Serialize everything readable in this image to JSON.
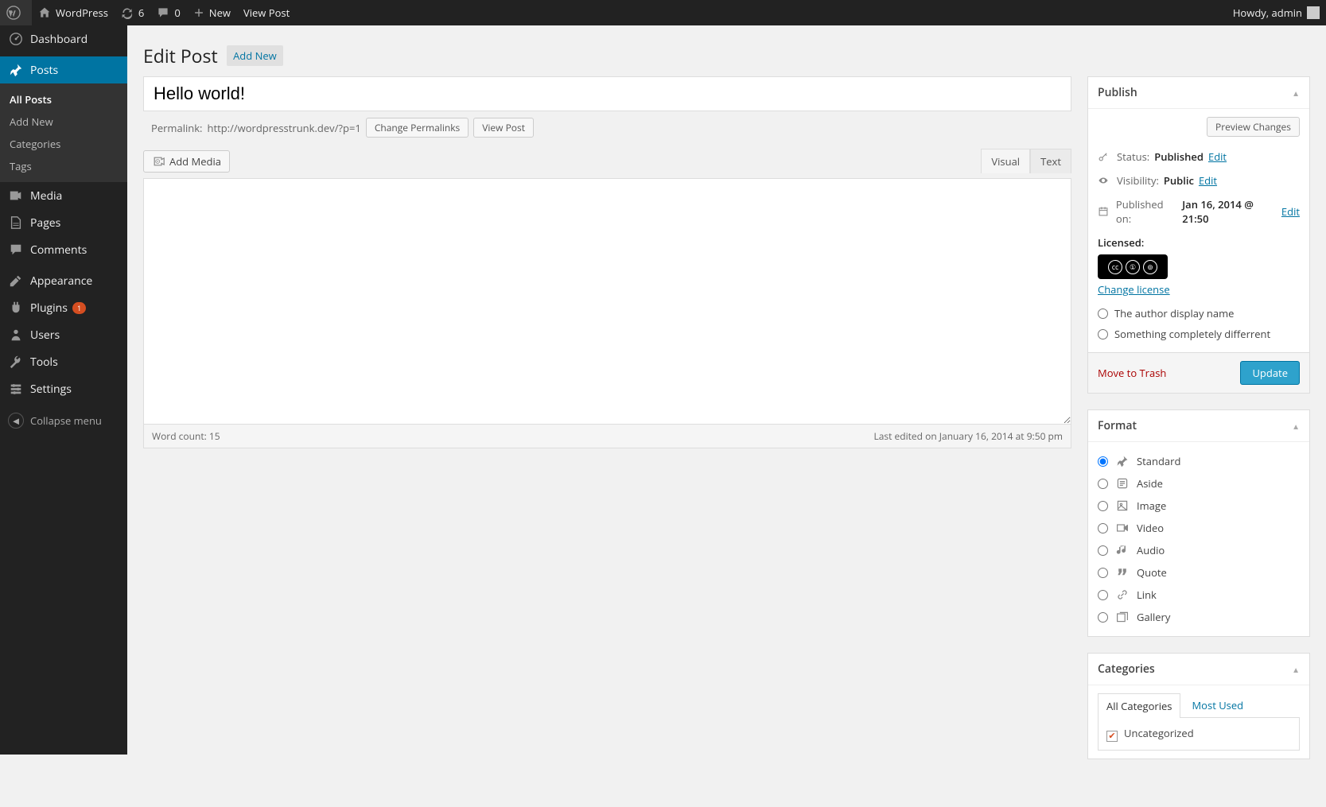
{
  "adminbar": {
    "site_name": "WordPress",
    "updates_count": "6",
    "comments_count": "0",
    "new_label": "New",
    "view_post_label": "View Post",
    "howdy": "Howdy, admin"
  },
  "menu": {
    "dashboard": "Dashboard",
    "posts": "Posts",
    "posts_sub": {
      "all": "All Posts",
      "add": "Add New",
      "cat": "Categories",
      "tags": "Tags"
    },
    "media": "Media",
    "pages": "Pages",
    "comments": "Comments",
    "appearance": "Appearance",
    "plugins": "Plugins",
    "plugins_badge": "1",
    "users": "Users",
    "tools": "Tools",
    "settings": "Settings",
    "collapse": "Collapse menu"
  },
  "heading": {
    "title": "Edit Post",
    "add_new": "Add New"
  },
  "post": {
    "title": "Hello world!",
    "permalink_label": "Permalink:",
    "permalink_url": "http://wordpresstrunk.dev/?p=1",
    "change_permalinks": "Change Permalinks",
    "view_post": "View Post",
    "add_media": "Add Media",
    "tab_visual": "Visual",
    "tab_text": "Text",
    "word_count_label": "Word count: ",
    "word_count": "15",
    "last_edited": "Last edited on January 16, 2014 at 9:50 pm"
  },
  "publish": {
    "title": "Publish",
    "preview": "Preview Changes",
    "status_label": "Status:",
    "status_value": "Published",
    "visibility_label": "Visibility:",
    "visibility_value": "Public",
    "published_label": "Published on:",
    "published_value": "Jan 16, 2014 @ 21:50",
    "edit": "Edit",
    "licensed": "Licensed:",
    "change_license": "Change license",
    "opt_author": "The author display name",
    "opt_other": "Something completely differrent",
    "trash": "Move to Trash",
    "update": "Update"
  },
  "format": {
    "title": "Format",
    "opts": {
      "standard": "Standard",
      "aside": "Aside",
      "image": "Image",
      "video": "Video",
      "audio": "Audio",
      "quote": "Quote",
      "link": "Link",
      "gallery": "Gallery"
    }
  },
  "categories": {
    "title": "Categories",
    "tab_all": "All Categories",
    "tab_most": "Most Used",
    "uncategorized": "Uncategorized"
  }
}
